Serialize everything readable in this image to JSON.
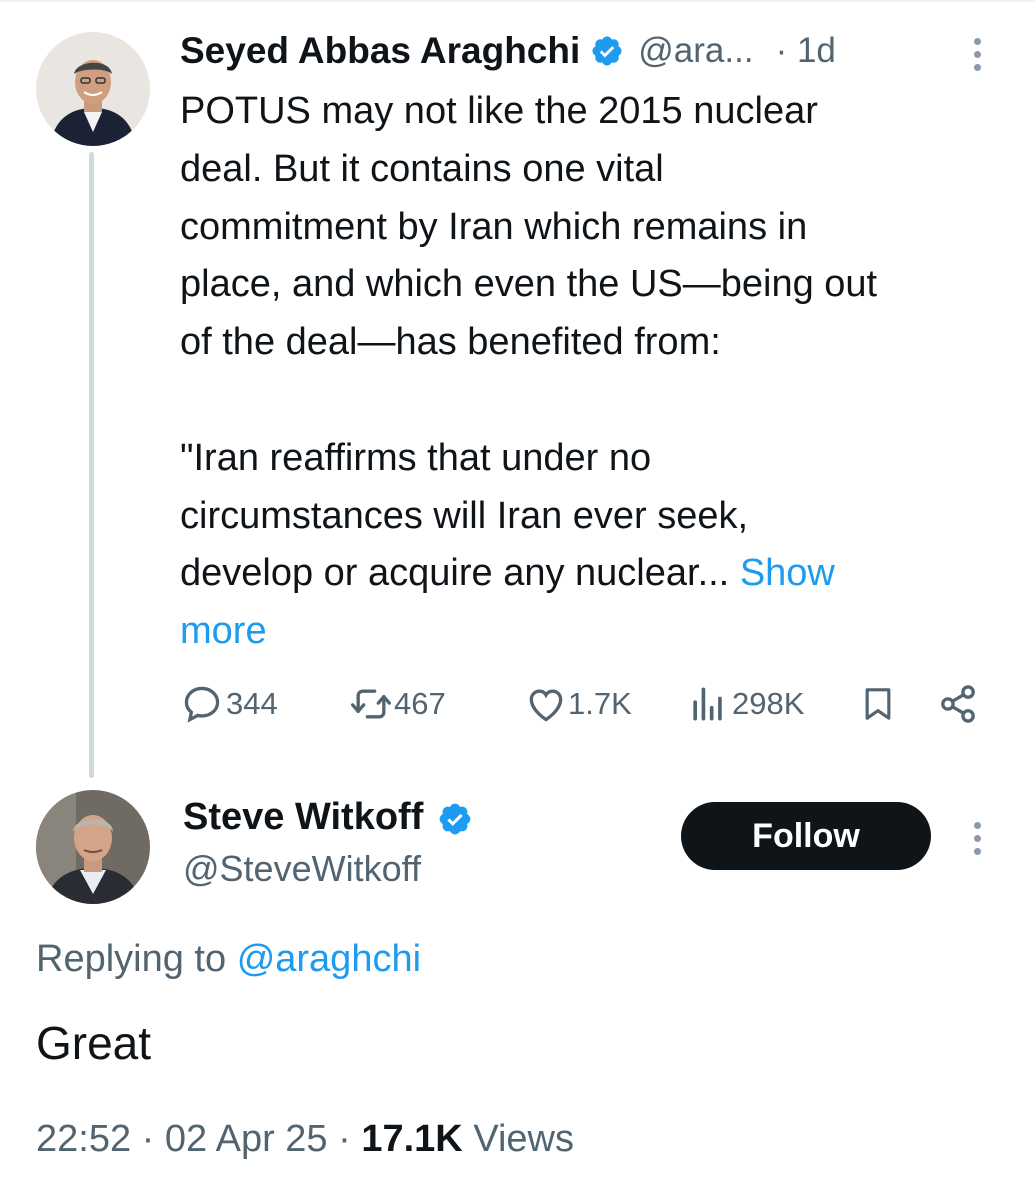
{
  "parent_tweet": {
    "author_name": "Seyed Abbas Araghchi",
    "handle": "@ara...",
    "time": "· 1d",
    "text_lines": [
      "POTUS may not like the 2015 nuclear",
      "deal. But it contains one vital",
      "commitment by Iran which remains in",
      "place, and which even the US—being out",
      "of the deal—has benefited from:"
    ],
    "quote_lines": [
      "\"Iran reaffirms that under no",
      "circumstances will Iran ever seek,",
      "develop or acquire any nuclear..."
    ],
    "show_more_a": "Show",
    "show_more_b": "more",
    "stats": {
      "replies": "344",
      "reposts": "467",
      "likes": "1.7K",
      "views": "298K"
    }
  },
  "reply_tweet": {
    "author_name": "Steve Witkoff",
    "handle": "@SteveWitkoff",
    "follow_label": "Follow",
    "replying_prefix": "Replying to",
    "replying_handle": "@araghchi",
    "text": "Great",
    "time": "22:52",
    "date": "02 Apr 25",
    "separator": "·",
    "views_count": "17.1K",
    "views_label": "Views"
  },
  "colors": {
    "accent": "#1d9bf0",
    "text_primary": "#0f1419",
    "text_secondary": "#536471",
    "thread_line": "#cfd9de"
  },
  "icons": [
    "verified-badge-icon",
    "more-options-icon",
    "reply-icon",
    "repost-icon",
    "like-icon",
    "views-icon",
    "bookmark-icon",
    "share-icon"
  ]
}
